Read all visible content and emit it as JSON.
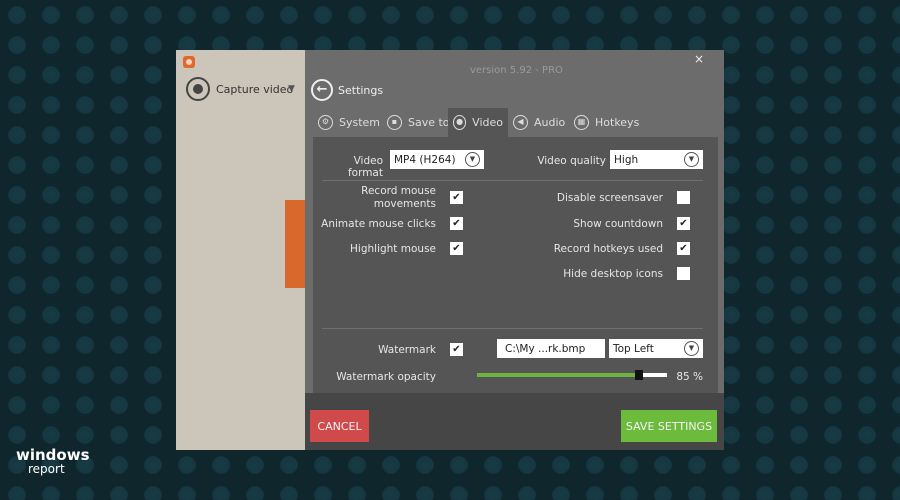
{
  "left_panel": {
    "capture_label": "Capture video",
    "dropdown_icon": "triangle-down-icon"
  },
  "dialog": {
    "version": "version 5.92 - PRO",
    "close": "×",
    "back": "←",
    "title": "Settings",
    "tabs": [
      {
        "label": "System",
        "icon": "⚙"
      },
      {
        "label": "Save to",
        "icon": "▪"
      },
      {
        "label": "Video",
        "icon": "●",
        "active": true
      },
      {
        "label": "Audio",
        "icon": "◀"
      },
      {
        "label": "Hotkeys",
        "icon": "▦"
      }
    ],
    "video_format": {
      "label": "Video format",
      "value": "MP4 (H264)"
    },
    "video_quality": {
      "label": "Video quality",
      "value": "High"
    },
    "left_options": [
      {
        "label": "Record mouse movements",
        "checked": true
      },
      {
        "label": "Animate mouse clicks",
        "checked": true
      },
      {
        "label": "Highlight mouse",
        "checked": true
      }
    ],
    "right_options": [
      {
        "label": "Disable screensaver",
        "checked": false
      },
      {
        "label": "Show countdown",
        "checked": true
      },
      {
        "label": "Record hotkeys used",
        "checked": true
      },
      {
        "label": "Hide desktop icons",
        "checked": false
      }
    ],
    "watermark": {
      "label": "Watermark",
      "checked": true,
      "file": "C:\\My ...rk.bmp",
      "position": "Top Left"
    },
    "opacity": {
      "label": "Watermark opacity",
      "value": 85,
      "text": "85 %"
    },
    "cancel": "CANCEL",
    "save": "SAVE SETTINGS",
    "check": "✔",
    "chev": "▼"
  },
  "branding": {
    "line1": "windows",
    "line2": "report"
  },
  "colors": {
    "cancel": "#d0494b",
    "save": "#6dbb3c",
    "slider": "#6db33f"
  }
}
